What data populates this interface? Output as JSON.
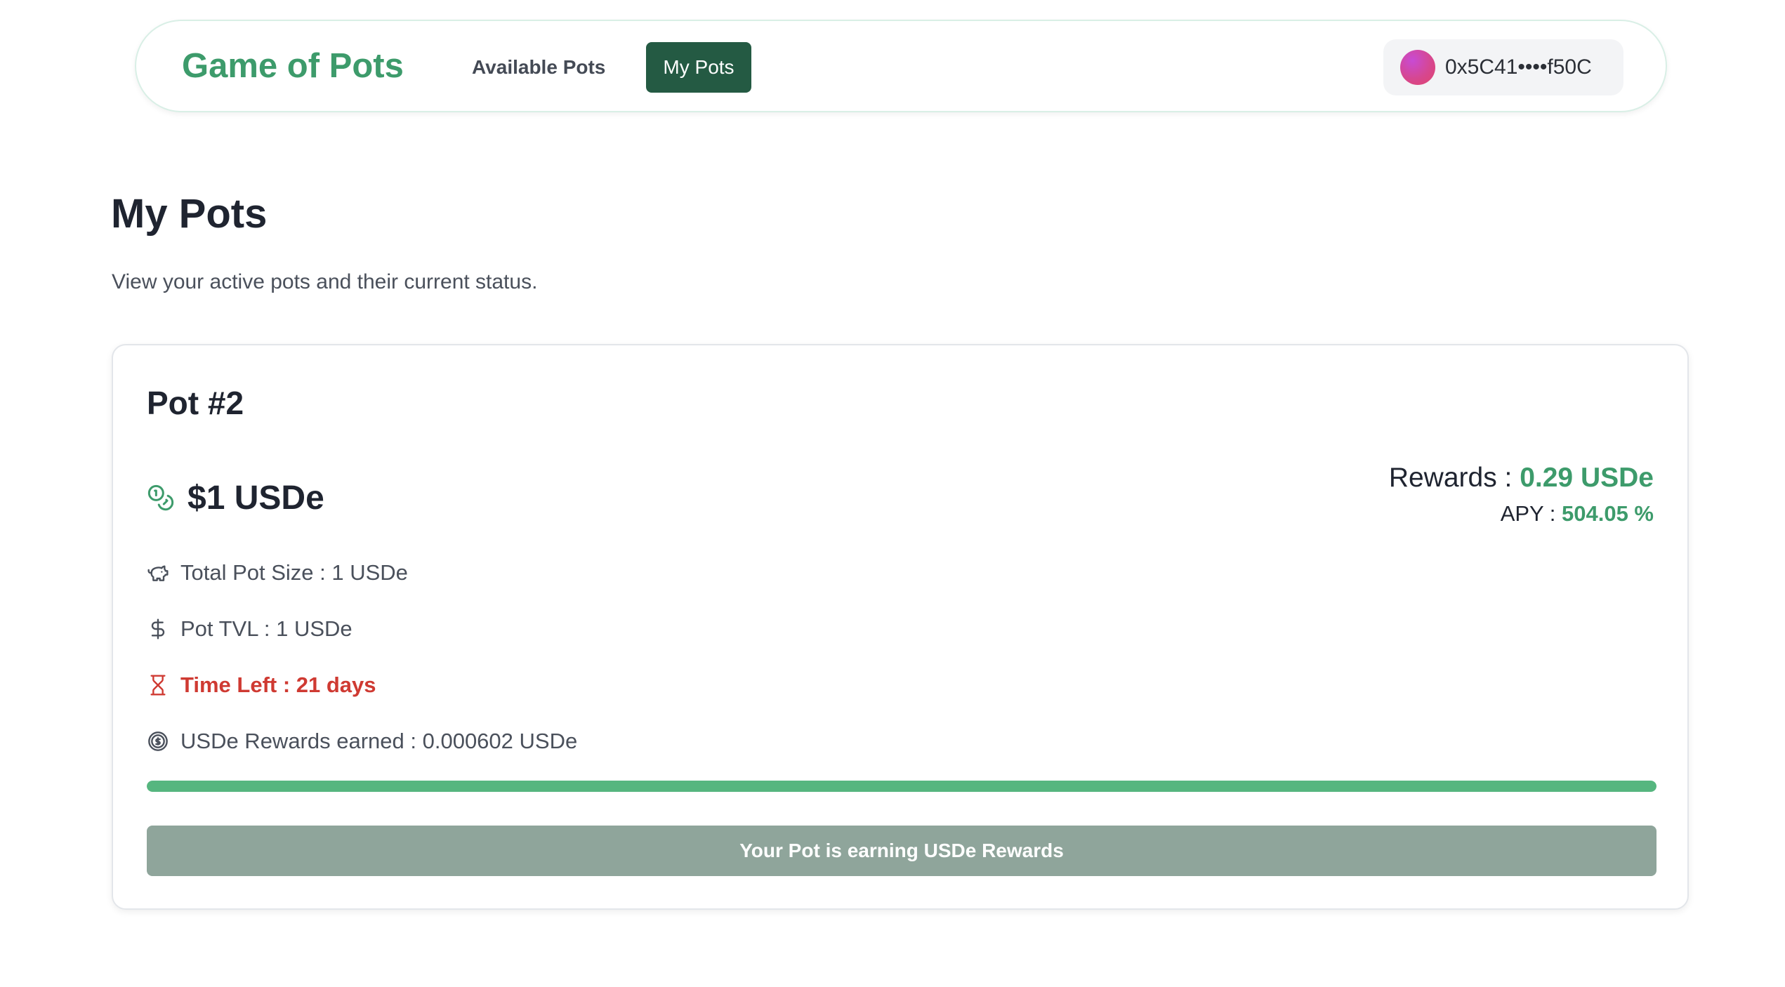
{
  "header": {
    "brand": "Game of Pots",
    "nav": [
      {
        "label": "Available Pots",
        "active": false
      },
      {
        "label": "My Pots",
        "active": true
      }
    ],
    "wallet": {
      "address": "0x5C41••••f50C"
    }
  },
  "page": {
    "title": "My Pots",
    "subtitle": "View your active pots and their current status."
  },
  "pot": {
    "title": "Pot #2",
    "amount": "$1 USDe",
    "rewards_label": "Rewards : ",
    "rewards_value": "0.29 USDe",
    "apy_label": "APY : ",
    "apy_value": "504.05 %",
    "details": [
      {
        "icon": "piggy-bank-icon",
        "text": "Total Pot Size : 1 USDe"
      },
      {
        "icon": "dollar-icon",
        "text": "Pot TVL : 1 USDe"
      },
      {
        "icon": "hourglass-icon",
        "text": "Time Left : 21 days"
      },
      {
        "icon": "coin-dollar-icon",
        "text": "USDe Rewards earned : 0.000602 USDe"
      }
    ],
    "progress_percent": 100,
    "status_button": "Your Pot is earning USDe Rewards"
  },
  "colors": {
    "brand_green": "#3d9b6b",
    "active_nav": "#245a43",
    "warning_red": "#cf3a32",
    "progress": "#56b67f",
    "status_button": "#8fa59b"
  }
}
